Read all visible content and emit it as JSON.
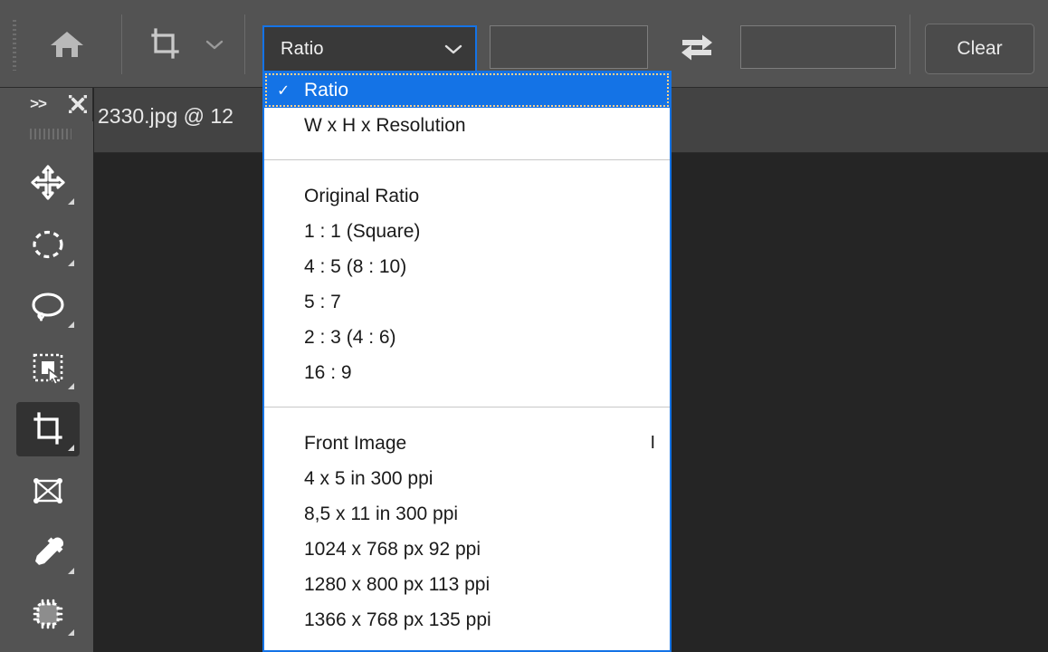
{
  "app": {
    "accent_blue": "#1473e6",
    "bar_bg": "#535353",
    "canvas_bg": "#252525"
  },
  "options_bar": {
    "grip_name": "options-bar-grip",
    "home_label": "Home",
    "tool_icon_label": "Crop Tool",
    "tool_preset_chevron": "chevron-down",
    "ratio_combo": {
      "value": "Ratio",
      "chevron": "chevron-down"
    },
    "width_field": {
      "value": "",
      "placeholder": ""
    },
    "swap_label": "Swaps height and width",
    "height_field": {
      "value": "",
      "placeholder": ""
    },
    "clear_label": "Clear"
  },
  "tools_panel": {
    "expand_label": ">>",
    "close_label": "Close",
    "items": [
      {
        "name": "move-tool",
        "label": "Move Tool",
        "active": false,
        "has_corner": true
      },
      {
        "name": "elliptical-marquee-tool",
        "label": "Elliptical Marquee Tool",
        "active": false,
        "has_corner": true
      },
      {
        "name": "lasso-tool",
        "label": "Lasso Tool",
        "active": false,
        "has_corner": true
      },
      {
        "name": "quick-selection-tool",
        "label": "Object Selection Tool",
        "active": false,
        "has_corner": true
      },
      {
        "name": "crop-tool",
        "label": "Crop Tool",
        "active": true,
        "has_corner": true
      },
      {
        "name": "frame-tool",
        "label": "Frame Tool",
        "active": false,
        "has_corner": false
      },
      {
        "name": "eyedropper-tool",
        "label": "Eyedropper Tool",
        "active": false,
        "has_corner": true
      },
      {
        "name": "spot-healing-tool",
        "label": "Spot Healing Brush Tool",
        "active": false,
        "has_corner": true
      }
    ]
  },
  "document": {
    "tab_title": "2330.jpg @ 12"
  },
  "ratio_menu": {
    "group1": [
      {
        "label": "Ratio",
        "selected": true,
        "checked": true,
        "shortcut": ""
      },
      {
        "label": "W x H x Resolution",
        "selected": false,
        "checked": false,
        "shortcut": ""
      }
    ],
    "group2": [
      {
        "label": "Original Ratio",
        "selected": false,
        "checked": false,
        "shortcut": ""
      },
      {
        "label": "1 : 1 (Square)",
        "selected": false,
        "checked": false,
        "shortcut": ""
      },
      {
        "label": "4 : 5 (8 : 10)",
        "selected": false,
        "checked": false,
        "shortcut": ""
      },
      {
        "label": "5 : 7",
        "selected": false,
        "checked": false,
        "shortcut": ""
      },
      {
        "label": "2 : 3 (4 : 6)",
        "selected": false,
        "checked": false,
        "shortcut": ""
      },
      {
        "label": "16 : 9",
        "selected": false,
        "checked": false,
        "shortcut": ""
      }
    ],
    "group3": [
      {
        "label": "Front Image",
        "selected": false,
        "checked": false,
        "shortcut": "I"
      },
      {
        "label": "4 x 5 in 300 ppi",
        "selected": false,
        "checked": false,
        "shortcut": ""
      },
      {
        "label": "8,5 x 11 in 300 ppi",
        "selected": false,
        "checked": false,
        "shortcut": ""
      },
      {
        "label": "1024 x 768 px 92 ppi",
        "selected": false,
        "checked": false,
        "shortcut": ""
      },
      {
        "label": "1280 x 800 px 113 ppi",
        "selected": false,
        "checked": false,
        "shortcut": ""
      },
      {
        "label": "1366 x 768 px 135 ppi",
        "selected": false,
        "checked": false,
        "shortcut": ""
      }
    ]
  }
}
